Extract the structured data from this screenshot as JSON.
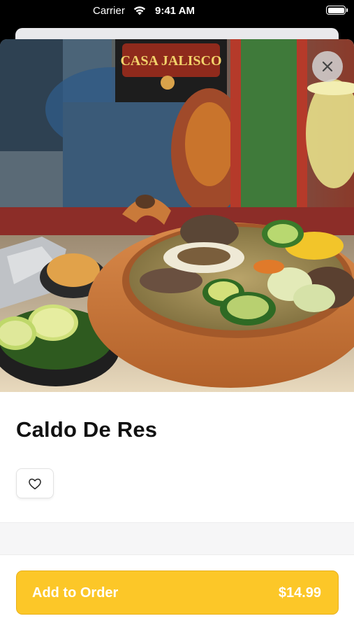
{
  "status_bar": {
    "carrier": "Carrier",
    "time": "9:41 AM"
  },
  "item": {
    "name": "Caldo De Res",
    "image_alt": "Caldo De Res soup in a clay bowl",
    "logo_text": "CASA JALISCO"
  },
  "actions": {
    "close_icon": "close-icon",
    "favorite_icon": "heart-icon",
    "add_to_order_label": "Add to Order",
    "price": "$14.99"
  },
  "colors": {
    "accent": "#fcc728",
    "title": "#111111"
  }
}
